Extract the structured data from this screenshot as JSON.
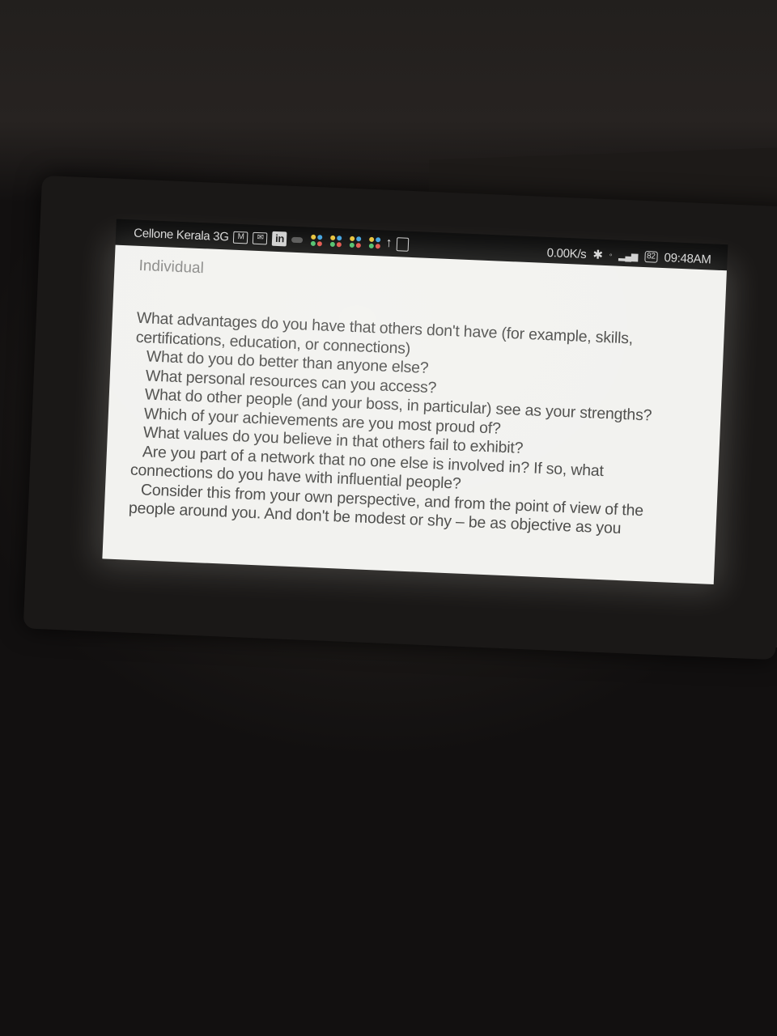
{
  "status_bar": {
    "carrier": "Cellone Kerala 3G",
    "network_speed": "0.00K/s",
    "battery": "82",
    "time": "09:48AM",
    "icons": [
      "gmail-icon",
      "email-icon",
      "linkedin-icon",
      "cloud-icon",
      "app-dots-icon",
      "upload-arrow-icon",
      "clipboard-icon",
      "bluetooth-icon",
      "wifi-icon",
      "signal-icon",
      "battery-icon"
    ]
  },
  "app": {
    "title": "Individual"
  },
  "body_lines": [
    "What advantages do you have that others don't have (for example, skills,",
    "certifications, education, or connections)",
    "What do you do better than anyone else?",
    "What personal resources can you access?",
    "What do other people (and your boss, in particular) see as your strengths?",
    "Which of your achievements are you most proud of?",
    "What values do you believe in that others fail to exhibit?",
    "Are you part of a network that no one else is involved in? If so, what",
    "connections do you have with influential people?",
    "Consider this from your own perspective, and from the point of view of the",
    "people around you. And don't be modest or shy – be as objective as you"
  ]
}
